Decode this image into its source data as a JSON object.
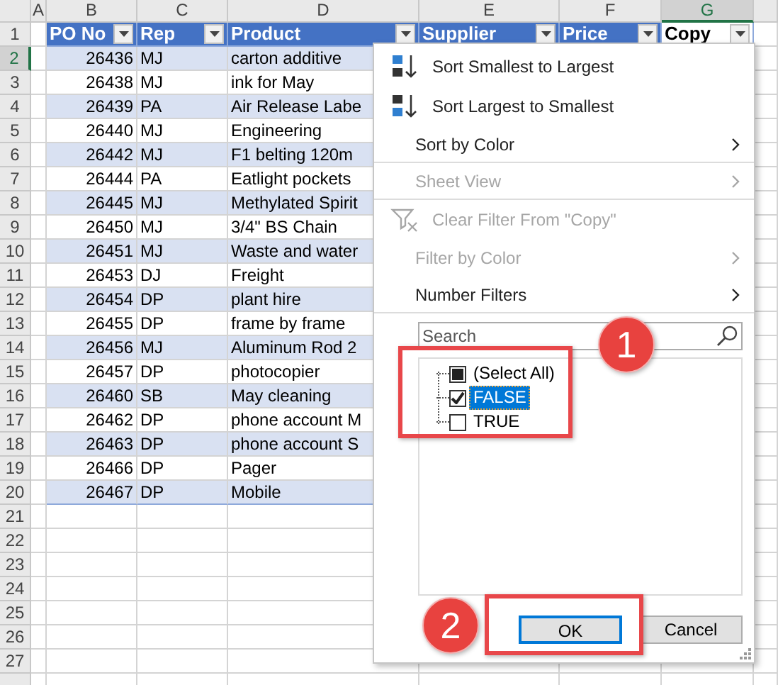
{
  "sheet": {
    "column_letters": [
      {
        "label": "A",
        "selected": false
      },
      {
        "label": "B",
        "selected": false
      },
      {
        "label": "C",
        "selected": false
      },
      {
        "label": "D",
        "selected": false
      },
      {
        "label": "E",
        "selected": false
      },
      {
        "label": "F",
        "selected": false
      },
      {
        "label": "G",
        "selected": true
      }
    ],
    "row_numbers": [
      {
        "label": "1",
        "selected": false
      },
      {
        "label": "2",
        "selected": true
      },
      {
        "label": "3",
        "selected": false
      },
      {
        "label": "4",
        "selected": false
      },
      {
        "label": "5",
        "selected": false
      },
      {
        "label": "6",
        "selected": false
      },
      {
        "label": "7",
        "selected": false
      },
      {
        "label": "8",
        "selected": false
      },
      {
        "label": "9",
        "selected": false
      },
      {
        "label": "10",
        "selected": false
      },
      {
        "label": "11",
        "selected": false
      },
      {
        "label": "12",
        "selected": false
      },
      {
        "label": "13",
        "selected": false
      },
      {
        "label": "14",
        "selected": false
      },
      {
        "label": "15",
        "selected": false
      },
      {
        "label": "16",
        "selected": false
      },
      {
        "label": "17",
        "selected": false
      },
      {
        "label": "18",
        "selected": false
      },
      {
        "label": "19",
        "selected": false
      },
      {
        "label": "20",
        "selected": false
      },
      {
        "label": "21",
        "selected": false
      },
      {
        "label": "22",
        "selected": false
      },
      {
        "label": "23",
        "selected": false
      },
      {
        "label": "24",
        "selected": false
      },
      {
        "label": "25",
        "selected": false
      },
      {
        "label": "26",
        "selected": false
      },
      {
        "label": "27",
        "selected": false
      }
    ],
    "table": {
      "columns": [
        {
          "label": "PO No",
          "selected": false
        },
        {
          "label": "Rep",
          "selected": false
        },
        {
          "label": "Product",
          "selected": false
        },
        {
          "label": "Supplier",
          "selected": false
        },
        {
          "label": "Price",
          "selected": false
        },
        {
          "label": "Copy",
          "selected": true
        }
      ],
      "rows": [
        [
          "26436",
          "MJ",
          "carton additive"
        ],
        [
          "26438",
          "MJ",
          "ink for May"
        ],
        [
          "26439",
          "PA",
          "Air Release Labe"
        ],
        [
          "26440",
          "MJ",
          "Engineering"
        ],
        [
          "26442",
          "MJ",
          "F1 belting 120m"
        ],
        [
          "26444",
          "PA",
          "Eatlight pockets"
        ],
        [
          "26445",
          "MJ",
          "Methylated Spirit"
        ],
        [
          "26450",
          "MJ",
          "3/4\" BS Chain"
        ],
        [
          "26451",
          "MJ",
          "Waste and water"
        ],
        [
          "26453",
          "DJ",
          "Freight"
        ],
        [
          "26454",
          "DP",
          "plant hire"
        ],
        [
          "26455",
          "DP",
          "frame by frame"
        ],
        [
          "26456",
          "MJ",
          "Aluminum Rod 2"
        ],
        [
          "26457",
          "DP",
          "photocopier"
        ],
        [
          "26460",
          "SB",
          "May cleaning"
        ],
        [
          "26462",
          "DP",
          "phone account M"
        ],
        [
          "26463",
          "DP",
          "phone account S"
        ],
        [
          "26466",
          "DP",
          "Pager"
        ],
        [
          "26467",
          "DP",
          "Mobile"
        ]
      ]
    }
  },
  "filter_menu": {
    "items": [
      {
        "kind": "sort",
        "label": "Sort Smallest to Largest",
        "descending": false,
        "disabled": false,
        "separator_after": false
      },
      {
        "kind": "sort",
        "label": "Sort Largest to Smallest",
        "descending": true,
        "disabled": false,
        "separator_after": false
      },
      {
        "kind": "submenu",
        "label": "Sort by Color",
        "disabled": false,
        "separator_after": true
      },
      {
        "kind": "submenu",
        "label": "Sheet View",
        "disabled": true,
        "separator_after": true
      },
      {
        "kind": "clear",
        "label": "Clear Filter From \"Copy\"",
        "disabled": true,
        "separator_after": false
      },
      {
        "kind": "submenu",
        "label": "Filter by Color",
        "disabled": true,
        "separator_after": false
      },
      {
        "kind": "submenu",
        "label": "Number Filters",
        "disabled": false,
        "separator_after": true
      }
    ],
    "search": {
      "placeholder": "Search"
    },
    "values": [
      {
        "label": "(Select All)",
        "checked": false,
        "partial": true,
        "selected": false
      },
      {
        "label": "FALSE",
        "checked": true,
        "partial": false,
        "selected": true
      },
      {
        "label": "TRUE",
        "checked": false,
        "partial": false,
        "selected": false
      }
    ],
    "buttons": [
      {
        "label": "OK",
        "default": true
      },
      {
        "label": "Cancel",
        "default": false
      }
    ]
  },
  "callouts": [
    {
      "number": "1"
    },
    {
      "number": "2"
    }
  ]
}
